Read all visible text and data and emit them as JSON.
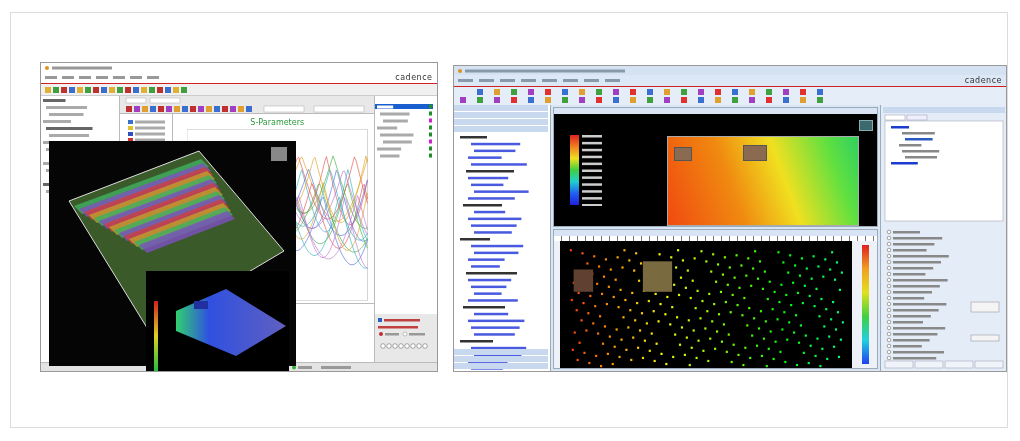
{
  "left_window": {
    "logo": "cadence",
    "chart": {
      "title": "S-Parameters"
    }
  },
  "right_window": {
    "logo": "cadence"
  }
}
